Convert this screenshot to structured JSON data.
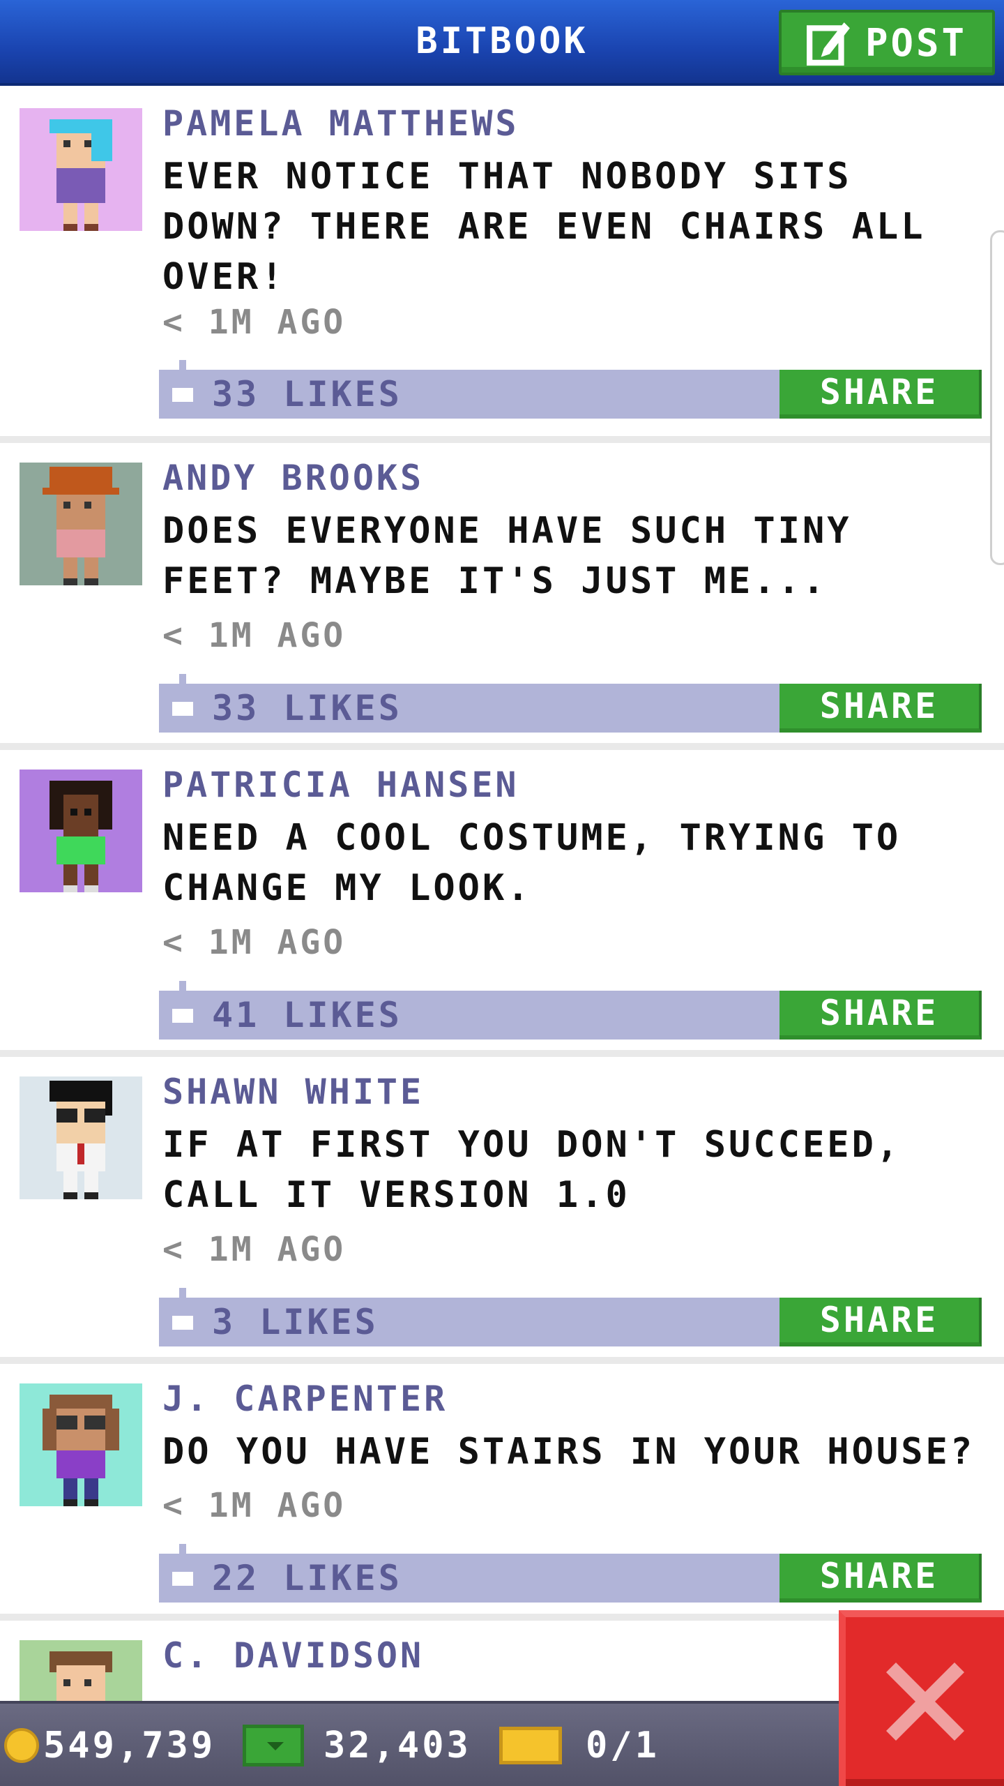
{
  "header": {
    "title": "BITBOOK",
    "post_label": "POST"
  },
  "posts": [
    {
      "author": "PAMELA MATTHEWS",
      "text": "EVER NOTICE THAT NOBODY SITS DOWN? THERE ARE EVEN CHAIRS ALL OVER!",
      "time": "< 1M AGO",
      "likes": "33 LIKES",
      "share": "SHARE",
      "avatar_bg": "#e6b3f0"
    },
    {
      "author": "ANDY BROOKS",
      "text": "DOES EVERYONE HAVE SUCH TINY FEET? MAYBE IT'S JUST ME...",
      "time": "< 1M AGO",
      "likes": "33 LIKES",
      "share": "SHARE",
      "avatar_bg": "#8fa89b"
    },
    {
      "author": "PATRICIA HANSEN",
      "text": "NEED A COOL COSTUME, TRYING TO CHANGE MY LOOK.",
      "time": "< 1M AGO",
      "likes": "41 LIKES",
      "share": "SHARE",
      "avatar_bg": "#b07ee0"
    },
    {
      "author": "SHAWN WHITE",
      "text": "IF AT FIRST YOU DON'T SUCCEED, CALL IT VERSION 1.0",
      "time": "< 1M AGO",
      "likes": "3 LIKES",
      "share": "SHARE",
      "avatar_bg": "#dce6ec"
    },
    {
      "author": "J. CARPENTER",
      "text": "DO YOU HAVE STAIRS IN YOUR HOUSE?",
      "time": "< 1M AGO",
      "likes": "22 LIKES",
      "share": "SHARE",
      "avatar_bg": "#8ee8d8"
    },
    {
      "author": "C. DAVIDSON",
      "avatar_bg": "#a9d49a"
    }
  ],
  "status": {
    "coins": "549,739",
    "cash": "32,403",
    "tickets": "0/1"
  },
  "colors": {
    "header": "#1a44b0",
    "accent_green": "#3aa637",
    "like_bar": "#b1b4d8",
    "close_red": "#e22a2a"
  },
  "icons": {
    "post": "edit-icon",
    "like": "thumbs-up-icon",
    "coin": "coin-icon",
    "cash": "cash-icon",
    "ticket": "ticket-icon",
    "close": "close-icon"
  }
}
